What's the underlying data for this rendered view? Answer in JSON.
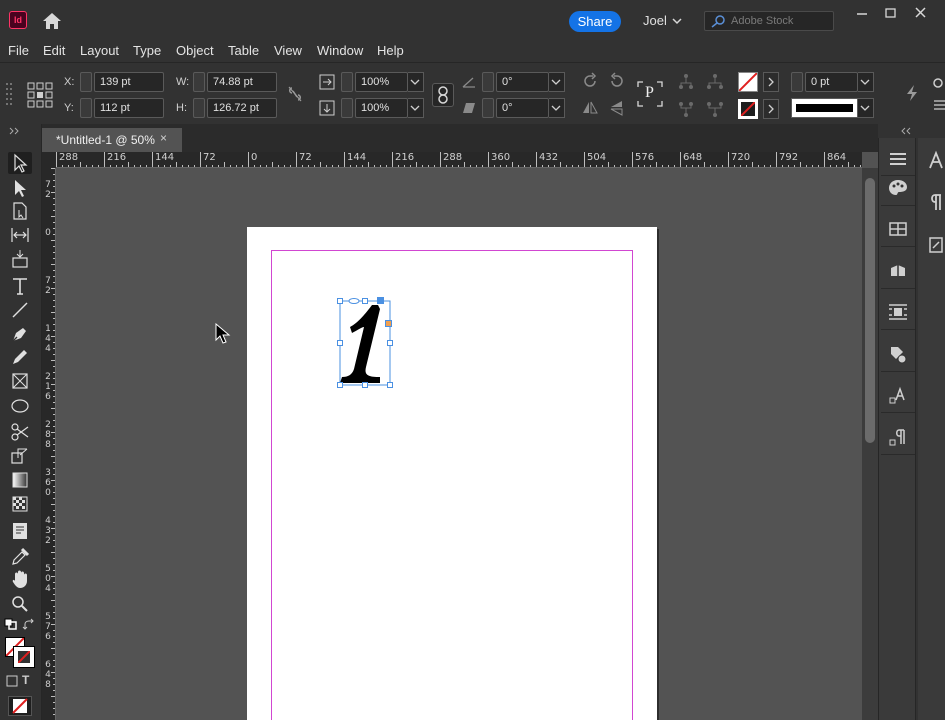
{
  "titlebar": {
    "app_logo_text": "Id",
    "share_label": "Share",
    "user_name": "Joel",
    "search_placeholder": "Adobe Stock"
  },
  "menubar": {
    "items": [
      "File",
      "Edit",
      "Layout",
      "Type",
      "Object",
      "Table",
      "View",
      "Window",
      "Help"
    ]
  },
  "control_panel": {
    "x_label": "X:",
    "x_value": "139 pt",
    "y_label": "Y:",
    "y_value": "112 pt",
    "w_label": "W:",
    "w_value": "74.88 pt",
    "h_label": "H:",
    "h_value": "126.72 pt",
    "scale_x": "100%",
    "scale_y": "100%",
    "rotation": "0°",
    "shear": "0°",
    "stroke_weight": "0 pt",
    "p_label": "P"
  },
  "document": {
    "tab_title": "*Untitled-1 @ 50%",
    "close_glyph": "×"
  },
  "rulers": {
    "horizontal": [
      "288",
      "216",
      "144",
      "72",
      "0",
      "72",
      "144",
      "216",
      "288",
      "360",
      "432",
      "504",
      "576",
      "648",
      "720",
      "792",
      "864"
    ],
    "vertical": [
      "72",
      "0",
      "72",
      "144",
      "216",
      "288",
      "360",
      "432",
      "504",
      "576",
      "648"
    ]
  },
  "canvas": {
    "glyph": "1"
  },
  "colors": {
    "accent_blue": "#1473e6",
    "margin_guide": "#d146d1",
    "selection": "#4a90e2"
  }
}
